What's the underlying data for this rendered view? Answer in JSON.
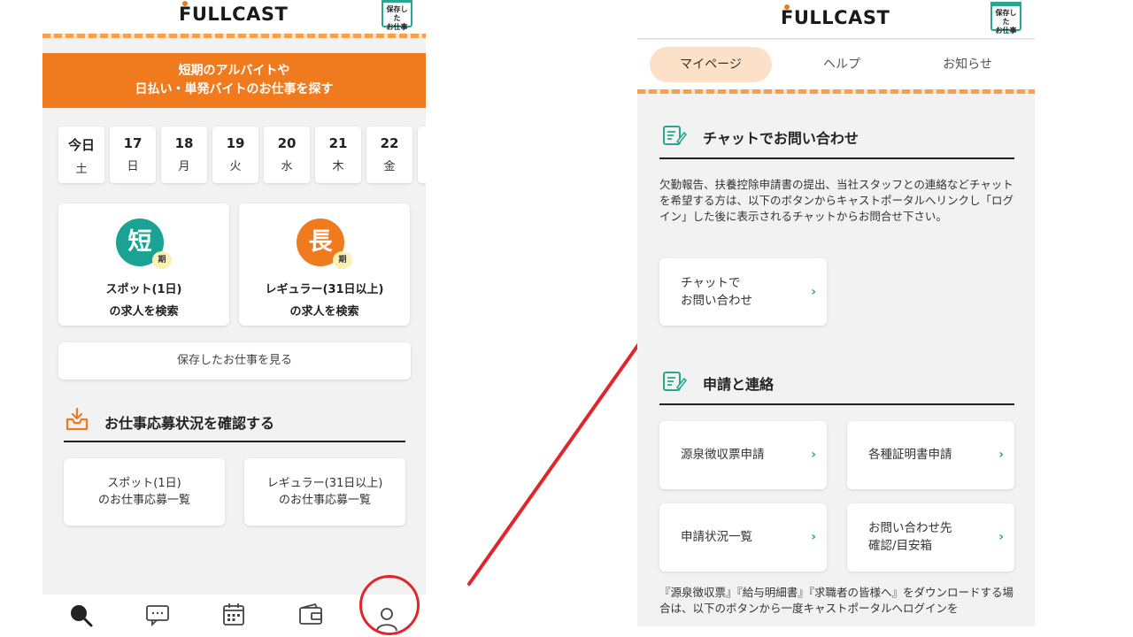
{
  "left": {
    "logo": "FULLCAST",
    "saved_jobs_icon": {
      "line1": "保存した",
      "line2": "お仕事"
    },
    "banner": {
      "line1": "短期のアルバイトや",
      "line2": "日払い・単発バイトのお仕事を探す"
    },
    "dates": [
      {
        "day": "今日",
        "weekday": "土"
      },
      {
        "day": "17",
        "weekday": "日"
      },
      {
        "day": "18",
        "weekday": "月"
      },
      {
        "day": "19",
        "weekday": "火"
      },
      {
        "day": "20",
        "weekday": "水"
      },
      {
        "day": "21",
        "weekday": "木"
      },
      {
        "day": "22",
        "weekday": "金"
      }
    ],
    "spot_card": {
      "badge": "短",
      "badge_small": "期",
      "line1": "スポット(1日)",
      "line2": "の求人を検索",
      "color": "#1aa394"
    },
    "regular_card": {
      "badge": "長",
      "badge_small": "期",
      "line1": "レギュラー(31日以上)",
      "line2": "の求人を検索",
      "color": "#f07a1e"
    },
    "saved_button": "保存したお仕事を見る",
    "status_section": {
      "title": "お仕事応募状況を確認する",
      "spot": {
        "line1": "スポット(1日)",
        "line2": "のお仕事応募一覧"
      },
      "regular": {
        "line1": "レギュラー(31日以上)",
        "line2": "のお仕事応募一覧"
      }
    },
    "tabbar": [
      "search-icon",
      "chat-icon",
      "calendar-icon",
      "wallet-icon",
      "person-icon"
    ]
  },
  "right": {
    "logo": "FULLCAST",
    "saved_jobs_icon": {
      "line1": "保存した",
      "line2": "お仕事"
    },
    "tabs": [
      "マイページ",
      "ヘルプ",
      "お知らせ"
    ],
    "chat_section": {
      "title": "チャットでお問い合わせ",
      "description": "欠勤報告、扶養控除申請書の提出、当社スタッフとの連絡などチャットを希望する方は、以下のボタンからキャストポータルへリンクし「ログイン」した後に表示されるチャットからお問合せ下さい。",
      "button": {
        "line1": "チャットで",
        "line2": "お問い合わせ"
      }
    },
    "apply_section": {
      "title": "申請と連絡",
      "buttons": [
        {
          "line1": "源泉徴収票申請",
          "line2": ""
        },
        {
          "line1": "各種証明書申請",
          "line2": ""
        },
        {
          "line1": "申請状況一覧",
          "line2": ""
        },
        {
          "line1": "お問い合わせ先",
          "line2": "確認/目安箱"
        }
      ],
      "note": "『源泉徴収票』『給与明細書』『求職者の皆様へ』をダウンロードする場合は、以下のボタンから一度キャストポータルへログインを"
    },
    "accent_color": "#2aa58f",
    "annotation_color": "#e1252b"
  }
}
